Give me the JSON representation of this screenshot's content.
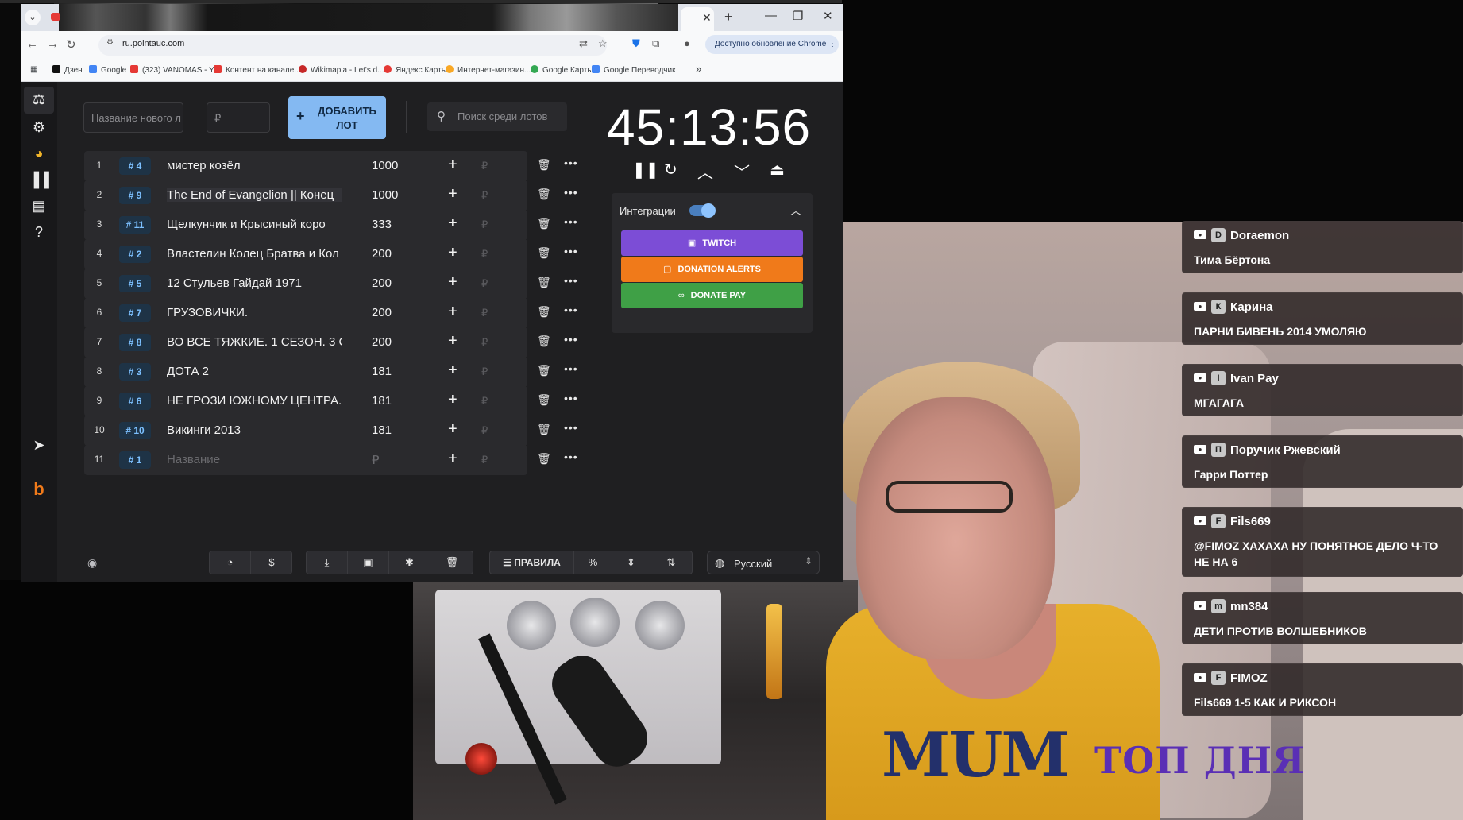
{
  "browser": {
    "url": "ru.pointauc.com",
    "update_label": "Доступно обновление Chrome",
    "bookmarks": [
      {
        "label": "Дзен",
        "color": "#111111"
      },
      {
        "label": "Google",
        "color": "#4285f4"
      },
      {
        "label": "(323) VANOMAS - Y...",
        "color": "#e53935"
      },
      {
        "label": "Контент на канале...",
        "color": "#e53935"
      },
      {
        "label": "Wikimapia - Let's d...",
        "color": "#c62828"
      },
      {
        "label": "Яндекс Карты",
        "color": "#e53935"
      },
      {
        "label": "Интернет-магазин...",
        "color": "#f9a825"
      },
      {
        "label": "Google Карты",
        "color": "#34a853"
      },
      {
        "label": "Google Переводчик",
        "color": "#4285f4"
      }
    ]
  },
  "toolbar": {
    "lot_name_placeholder": "Название нового л",
    "amount_placeholder": "₽",
    "add_label": "ДОБАВИТЬ ЛОТ",
    "search_placeholder": "Поиск среди лотов"
  },
  "lots": [
    {
      "num": "1",
      "tag": "# 4",
      "name": "мистер козёл",
      "amount": "1000"
    },
    {
      "num": "2",
      "tag": "# 9",
      "name": "The End of Evangelion || Конец",
      "amount": "1000"
    },
    {
      "num": "3",
      "tag": "# 11",
      "name": "Щелкунчик и Крысиный коро",
      "amount": "333"
    },
    {
      "num": "4",
      "tag": "# 2",
      "name": "Властелин Колец Братва и Кол",
      "amount": "200"
    },
    {
      "num": "5",
      "tag": "# 5",
      "name": "12 Стульев Гайдай 1971",
      "amount": "200"
    },
    {
      "num": "6",
      "tag": "# 7",
      "name": "ГРУЗОВИЧКИ.",
      "amount": "200"
    },
    {
      "num": "7",
      "tag": "# 8",
      "name": "ВО ВСЕ ТЯЖКИЕ. 1 СЕЗОН. 3 С",
      "amount": "200"
    },
    {
      "num": "8",
      "tag": "# 3",
      "name": "ДОТА 2",
      "amount": "181"
    },
    {
      "num": "9",
      "tag": "# 6",
      "name": "НЕ ГРОЗИ ЮЖНОМУ ЦЕНТРА.",
      "amount": "181"
    },
    {
      "num": "10",
      "tag": "# 10",
      "name": "Викинги 2013",
      "amount": "181"
    },
    {
      "num": "11",
      "tag": "# 1",
      "name": "Название",
      "amount": "₽",
      "placeholder": true
    }
  ],
  "lot_rub_symbol": "₽",
  "timer": {
    "value": "45:13:56"
  },
  "integrations": {
    "label": "Интеграции",
    "enabled": true,
    "twitch": {
      "label": "TWITCH",
      "color": "#7c4dd6"
    },
    "donation_alerts": {
      "label": "DONATION ALERTS",
      "color": "#f07a1a"
    },
    "donate_pay": {
      "label": "DONATE PAY",
      "color": "#3fa046"
    }
  },
  "bottom": {
    "rules_label": "ПРАВИЛА",
    "percent_label": "%",
    "language": "Русский"
  },
  "chat": [
    {
      "user": "Doraemon",
      "avatar": "D",
      "text": "Тима Бёртона"
    },
    {
      "user": "Карина",
      "avatar": "К",
      "text": "ПАРНИ БИВЕНЬ 2014 УМОЛЯЮ"
    },
    {
      "user": "Ivan Pay",
      "avatar": "I",
      "text": "МГАГАГА"
    },
    {
      "user": "Поручик Ржевский",
      "avatar": "П",
      "text": "Гарри Поттер"
    },
    {
      "user": "Fils669",
      "avatar": "F",
      "text": "@FIMOZ ХАХАХА НУ ПОНЯТНОЕ ДЕЛО Ч-ТО НЕ НА 6"
    },
    {
      "user": "mn384",
      "avatar": "m",
      "text": "ДЕТИ ПРОТИВ ВОЛШЕБНИКОВ"
    },
    {
      "user": "FIMOZ",
      "avatar": "F",
      "text": "Fils669 1-5 КАК И РИКСОН"
    }
  ],
  "overlay": {
    "top_day": "ТОП ДНЯ",
    "jersey": "MUM"
  }
}
